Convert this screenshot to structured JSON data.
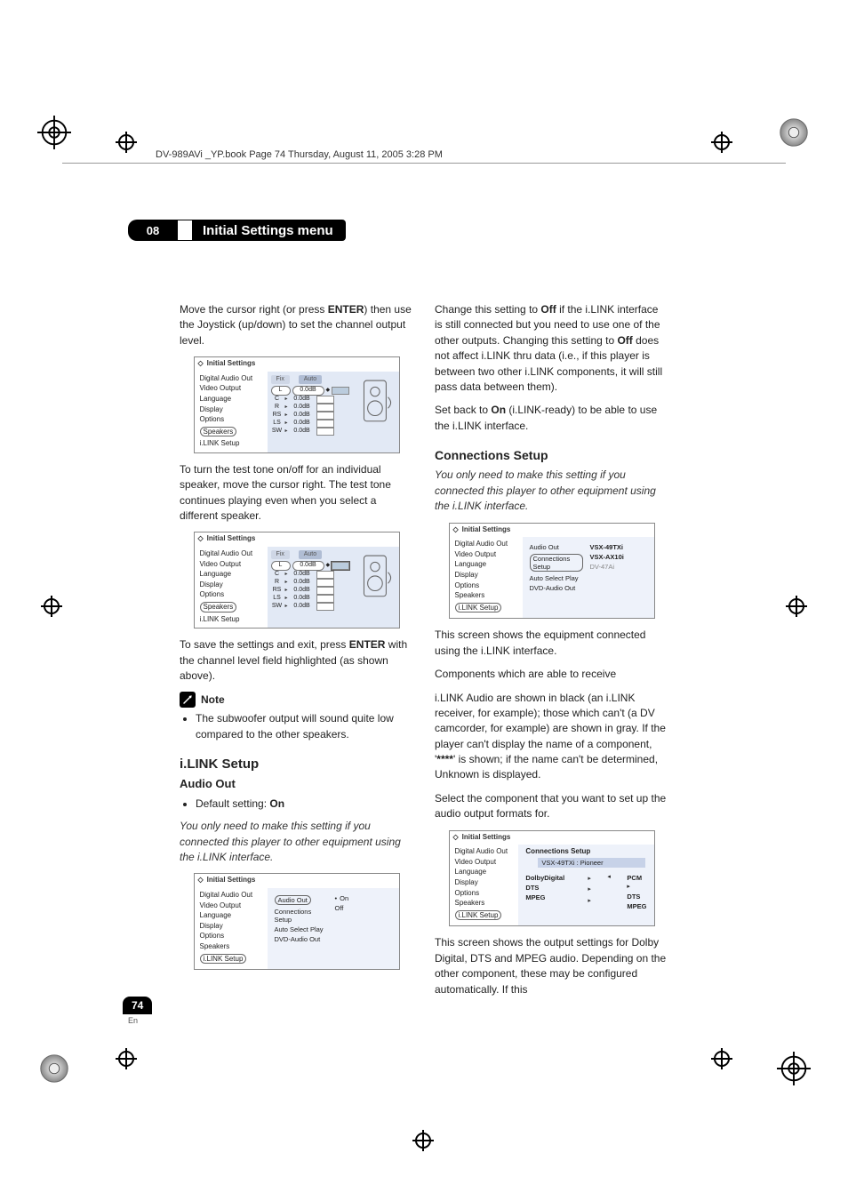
{
  "header_line": "DV-989AVi _YP.book  Page 74  Thursday, August 11, 2005  3:28 PM",
  "chapter": {
    "num": "08",
    "title": "Initial Settings menu"
  },
  "left": {
    "p1a": "Move the cursor right (or press ",
    "p1b": "ENTER",
    "p1c": ") then use the Joystick (up/down) to set the channel output level.",
    "p2": "To turn the test tone on/off for an individual speaker, move the cursor right. The test tone continues playing even when you select a different speaker.",
    "p3a": "To save the settings and exit, press ",
    "p3b": "ENTER",
    "p3c": " with the channel level field highlighted (as shown above).",
    "note_label": "Note",
    "note_item": "The subwoofer output will sound quite low compared to the other speakers.",
    "section": "i.LINK Setup",
    "sub": "Audio Out",
    "default_a": "Default setting: ",
    "default_b": "On",
    "p4": "You only need to make this setting if you connected this player to other equipment using the i.LINK interface."
  },
  "right": {
    "p1a": "Change this setting to ",
    "p1b": "Off",
    "p1c": " if the i.LINK interface is still connected but you need to use one of the other outputs. Changing this setting to ",
    "p1d": "Off",
    "p1e": " does not affect i.LINK thru data (i.e., if this player is between two other i.LINK components, it will still pass data between them).",
    "p2a": "Set back to ",
    "p2b": "On",
    "p2c": " (i.LINK-ready) to be able to use the i.LINK interface.",
    "section": "Connections Setup",
    "p3": "You only need to make this setting if you connected this player to other equipment using the i.LINK interface.",
    "p4": "This screen shows the equipment connected using the i.LINK interface.",
    "p5": "Components which are able to receive",
    "p6a": "i.LINK Audio are shown in black (an i.LINK receiver, for example); those which can't (a DV camcorder, for example) are shown in gray. If the player can't display the name of a component, '",
    "p6b": "****",
    "p6c": "' is shown; if the name can't be determined, Unknown is displayed.",
    "p7": "Select the component that you want to set up the audio output formats for.",
    "p8": "This screen shows the output settings for Dolby Digital, DTS and MPEG audio. Depending on the other component, these may be configured automatically. If this"
  },
  "mini": {
    "title": "Initial Settings",
    "sidebar": [
      "Digital Audio Out",
      "Video Output",
      "Language",
      "Display",
      "Options",
      "Speakers",
      "i.LINK Setup"
    ],
    "fix": "Fix",
    "auto": "Auto",
    "channels": [
      "L",
      "C",
      "R",
      "RS",
      "LS",
      "SW"
    ],
    "level": "0.0dB",
    "ilink_menu": [
      "Audio Out",
      "Connections Setup",
      "Auto Select Play",
      "DVD-Audio Out"
    ],
    "onoff": [
      "On",
      "Off"
    ],
    "conn_list": [
      "VSX-49TXi",
      "VSX-AX10i",
      "DV-47Ai"
    ],
    "conn_head": "Connections Setup",
    "conn_sub": "VSX-49TXi : Pioneer",
    "fmt_left": [
      "DolbyDigital",
      "DTS",
      "MPEG"
    ],
    "fmt_right": [
      "PCM",
      "DTS",
      "MPEG"
    ]
  },
  "footer": {
    "page": "74",
    "lang": "En"
  }
}
